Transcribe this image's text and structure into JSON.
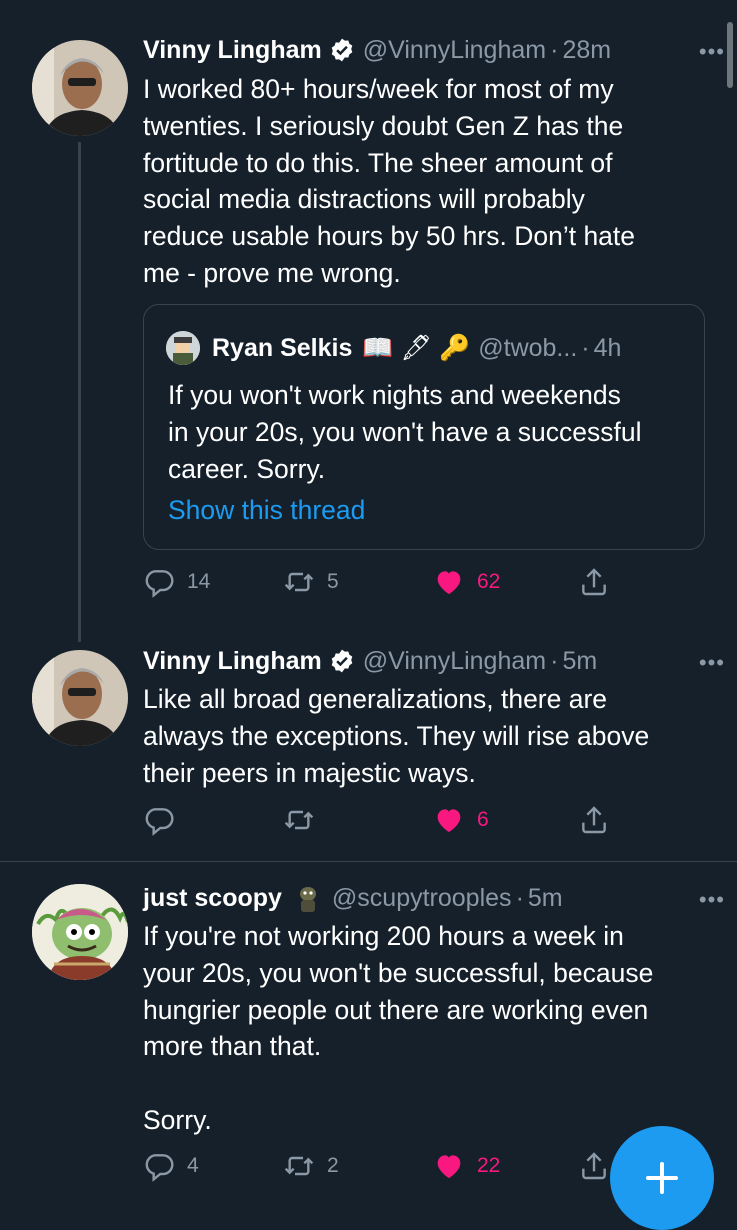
{
  "tweets": [
    {
      "name": "Vinny Lingham",
      "handle": "@VinnyLingham",
      "sep": "·",
      "time": "28m",
      "text": "I worked 80+ hours/week for most of my\ntwenties. I seriously doubt Gen Z has the\nfortitude to do this. The sheer amount of\nsocial media distractions will probably\nreduce usable hours by 50 hrs. Don’t hate\nme - prove me wrong.",
      "reply_count": "14",
      "retweet_count": "5",
      "like_count": "62",
      "quote": {
        "name": "Ryan Selkis",
        "emoji": "📖 🖋 🔑",
        "handle": "@twob...",
        "sep": "·",
        "time": "4h",
        "text": "If you won't work nights and weekends\nin your 20s, you won't have a successful\ncareer. Sorry.",
        "show_thread": "Show this thread"
      }
    },
    {
      "name": "Vinny Lingham",
      "handle": "@VinnyLingham",
      "sep": "·",
      "time": "5m",
      "text": "Like all broad generalizations, there are\nalways the exceptions. They will rise above\ntheir peers in majestic ways.",
      "reply_count": "",
      "retweet_count": "",
      "like_count": "6"
    },
    {
      "name": "just scoopy",
      "handle": "@scupytrooples",
      "sep": "·",
      "time": "5m",
      "text": "If you're not working 200 hours a week in\nyour 20s, you won't be successful, because\nhungrier people out there are working even\nmore than that.\n\nSorry.",
      "reply_count": "4",
      "retweet_count": "2",
      "like_count": "22"
    }
  ],
  "more_label": "•••",
  "colors": {
    "background": "#15202b",
    "text": "#ffffff",
    "secondary": "#8b98a5",
    "accent": "#1d9bf0",
    "like": "#f91880",
    "border": "#38444d"
  },
  "icons": [
    "verified-badge-icon",
    "more-icon",
    "reply-icon",
    "retweet-icon",
    "heart-icon",
    "share-icon",
    "compose-plus-icon"
  ]
}
